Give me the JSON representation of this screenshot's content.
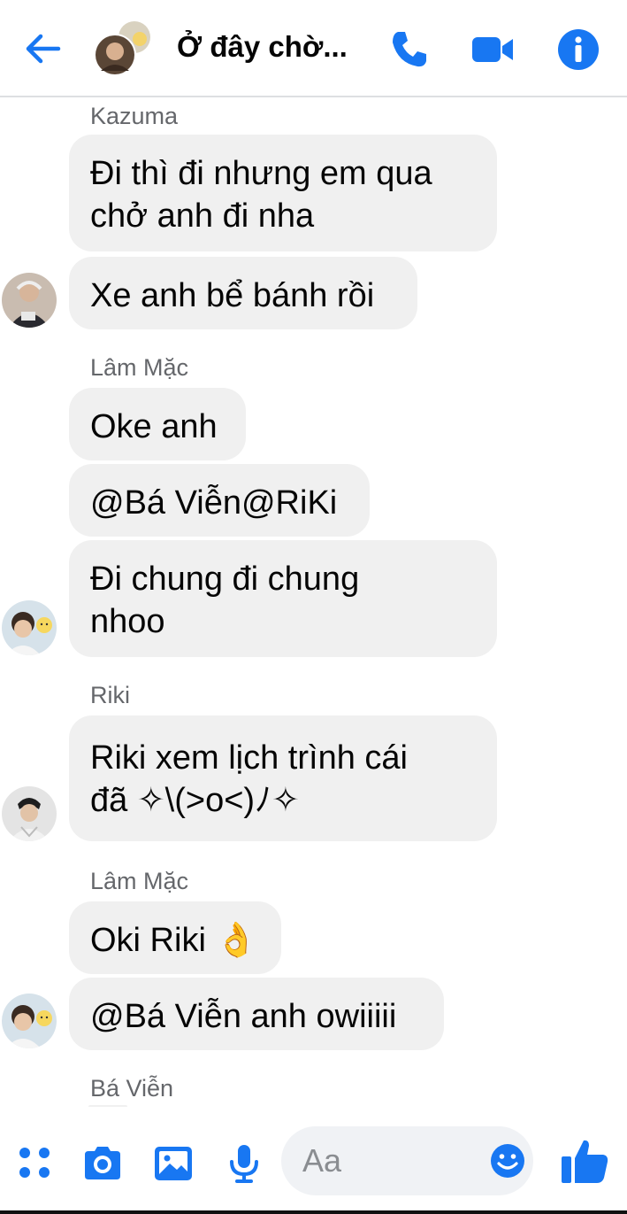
{
  "header": {
    "title": "Ở đây chờ...",
    "accent_color": "#1877f2"
  },
  "messages": [
    {
      "sender": "Kazuma",
      "texts": [
        "Đi thì đi nhưng em qua\nchở anh đi nha",
        "Xe anh bể bánh rồi"
      ]
    },
    {
      "sender": "Lâm Mặc",
      "texts": [
        "Oke anh",
        "@Bá Viễn@RiKi",
        "Đi chung đi chung\nnhoo"
      ]
    },
    {
      "sender": "Riki",
      "texts": [
        "Riki xem lịch trình cái\nđã ✧\\(>o<)ﾉ✧"
      ]
    },
    {
      "sender": "Lâm Mặc",
      "texts": [
        "Oki Riki 👌",
        "@Bá Viễn anh owiiiii"
      ]
    },
    {
      "sender": "Bá Viễn",
      "texts": []
    }
  ],
  "composer": {
    "placeholder": "Aa"
  }
}
